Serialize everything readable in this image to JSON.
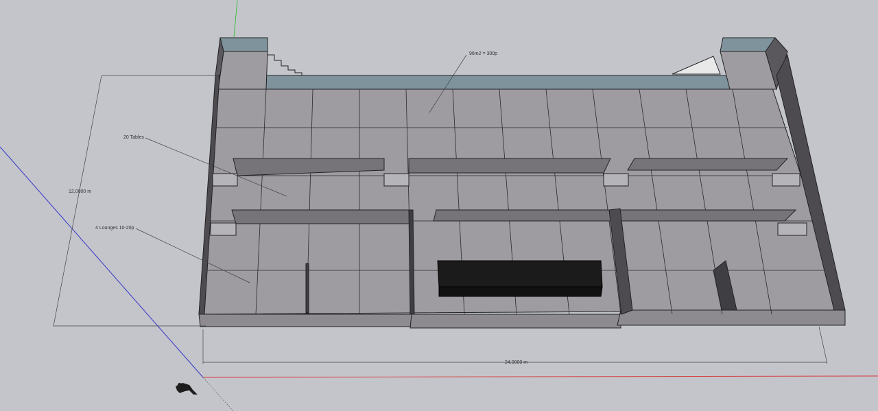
{
  "annotations": {
    "area_note": "96m2 = 300p",
    "tables_note": "20 Tables",
    "lounges_note": "4 Lounges  10-20p"
  },
  "dimensions": {
    "depth": "12,0000 m",
    "width": "24,0000 m"
  },
  "colors": {
    "background": "#c4c5cb",
    "floor_top": "#9e9ba1",
    "wall_side": "#5a585d",
    "wall_dark": "#3f3e42",
    "glass": "#7f939d",
    "black_block": "#1b1b1b",
    "axis_green": "#3fbf3f",
    "axis_red": "#d63a3a",
    "axis_blue": "#3434c8"
  },
  "icons": {
    "figure": "person-figure-icon"
  }
}
